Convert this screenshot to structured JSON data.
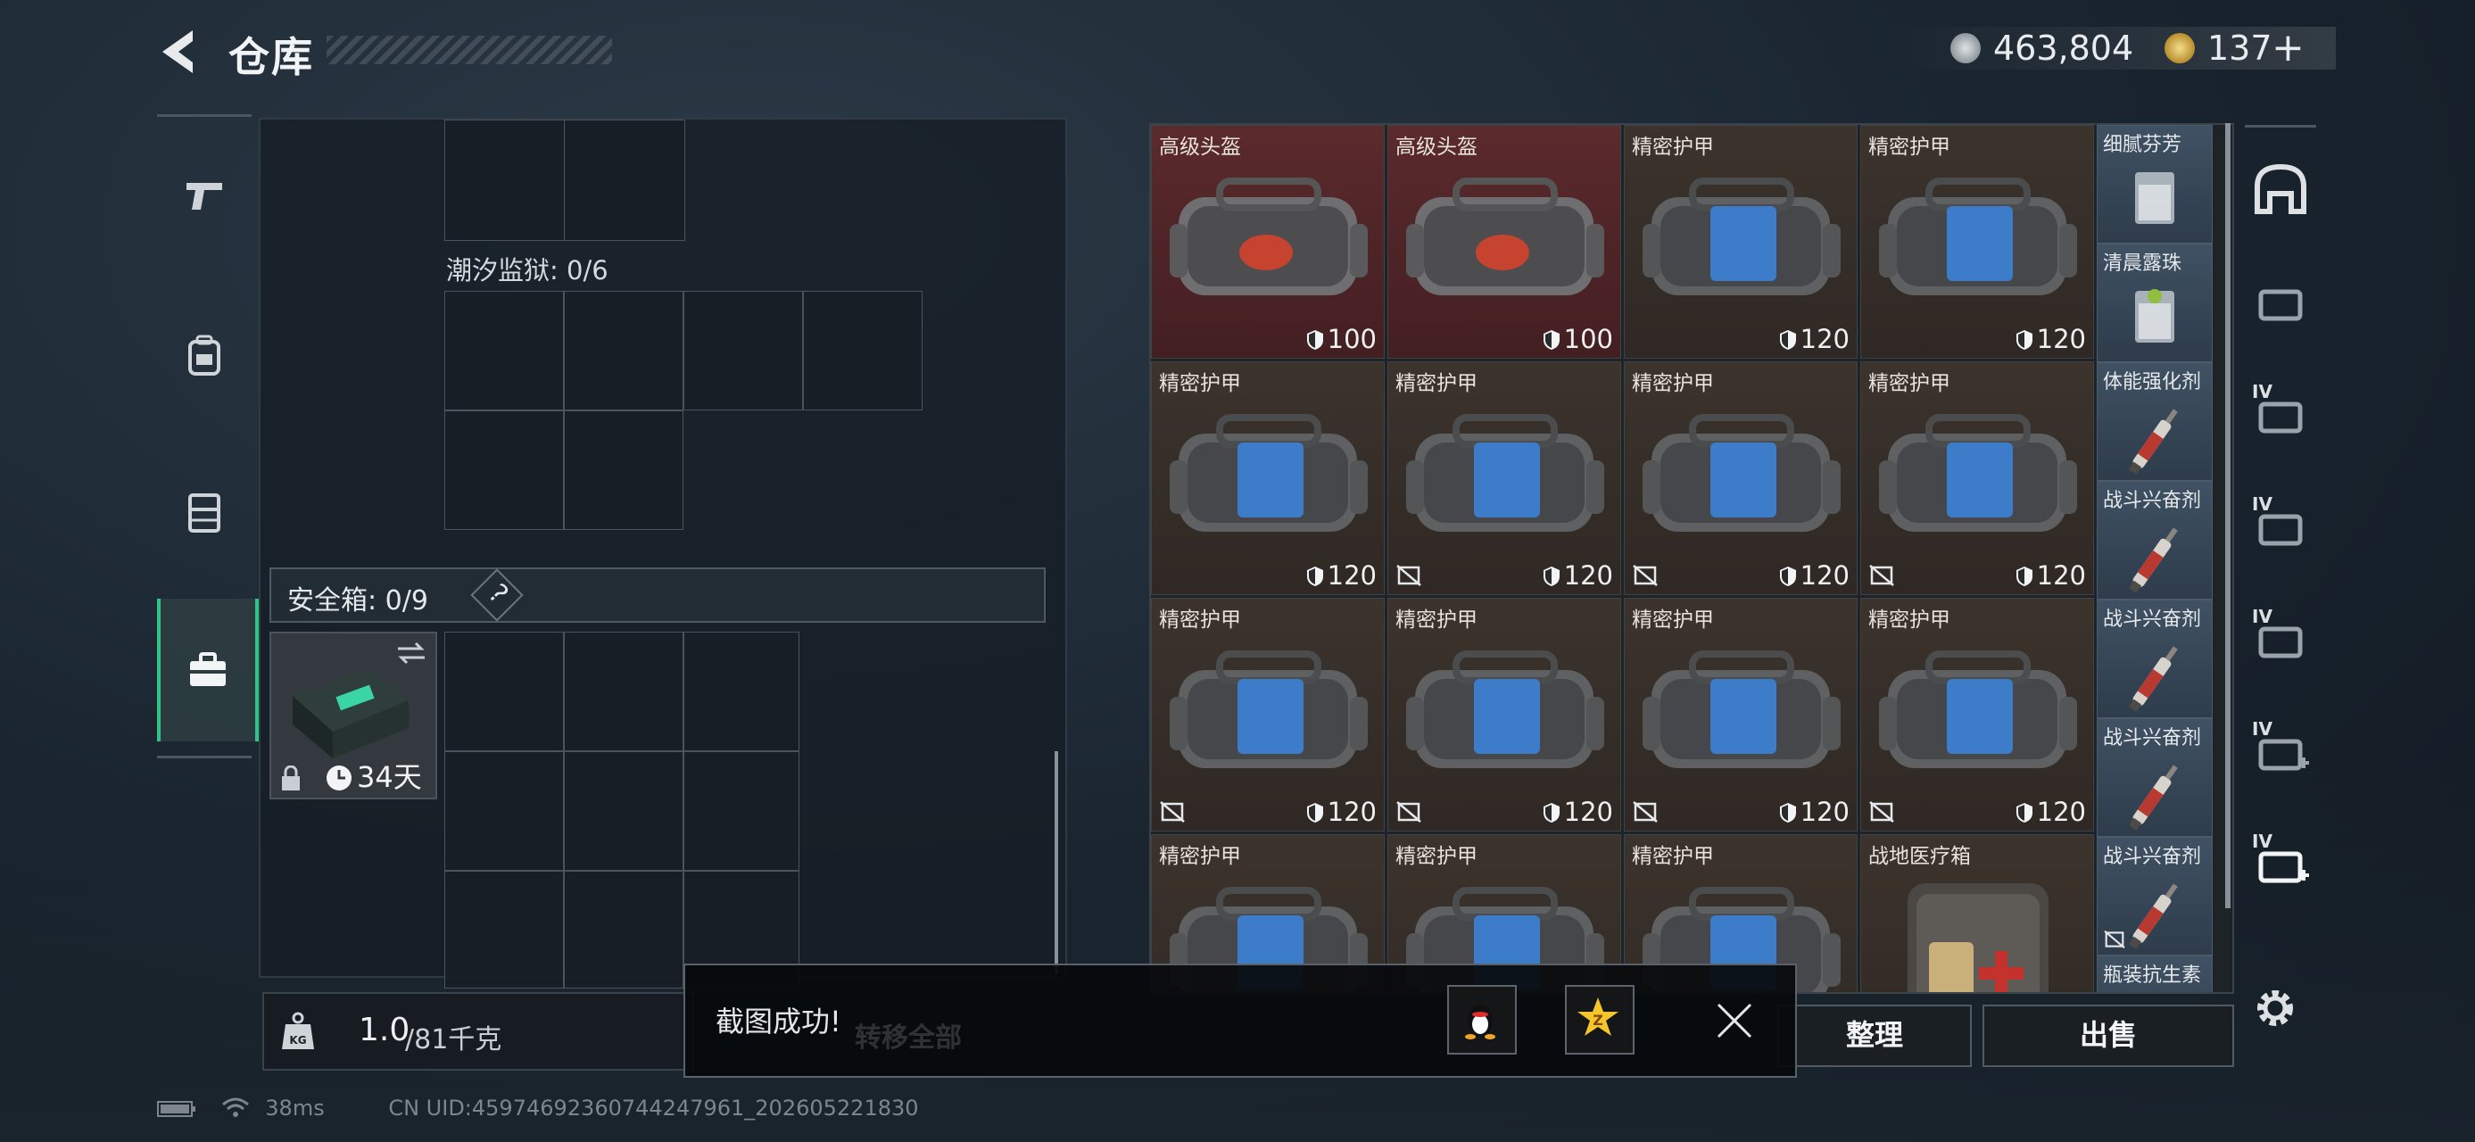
{
  "header": {
    "title": "仓库",
    "currency": [
      {
        "icon": "silver-coin-icon",
        "value": "463,804"
      },
      {
        "icon": "gold-coin-icon",
        "value": "137"
      }
    ],
    "currency_add": "+"
  },
  "left_nav": [
    {
      "icon": "pistol-icon"
    },
    {
      "icon": "backpack-icon"
    },
    {
      "icon": "vest-icon"
    },
    {
      "icon": "briefcase-icon",
      "active": true
    }
  ],
  "left_panel": {
    "prison_label": "潮汐监狱: 0/6",
    "safe_label": "安全箱: 0/9",
    "safe_help": "?",
    "safe_days": "34天"
  },
  "grid_cells": [
    {
      "name": "高级头盔",
      "durability": "100",
      "bg": "red",
      "item": "helmet",
      "nobind": false
    },
    {
      "name": "高级头盔",
      "durability": "100",
      "bg": "red",
      "item": "helmet",
      "nobind": false
    },
    {
      "name": "精密护甲",
      "durability": "120",
      "bg": "brown",
      "item": "armor",
      "nobind": false
    },
    {
      "name": "精密护甲",
      "durability": "120",
      "bg": "brown",
      "item": "armor",
      "nobind": false
    },
    {
      "name": "精密护甲",
      "durability": "120",
      "bg": "brown",
      "item": "armor",
      "nobind": false
    },
    {
      "name": "精密护甲",
      "durability": "120",
      "bg": "brown",
      "item": "armor",
      "nobind": true
    },
    {
      "name": "精密护甲",
      "durability": "120",
      "bg": "brown",
      "item": "armor",
      "nobind": true
    },
    {
      "name": "精密护甲",
      "durability": "120",
      "bg": "brown",
      "item": "armor",
      "nobind": true
    },
    {
      "name": "精密护甲",
      "durability": "120",
      "bg": "brown",
      "item": "armor",
      "nobind": true
    },
    {
      "name": "精密护甲",
      "durability": "120",
      "bg": "brown",
      "item": "armor",
      "nobind": true
    },
    {
      "name": "精密护甲",
      "durability": "120",
      "bg": "brown",
      "item": "armor",
      "nobind": true
    },
    {
      "name": "精密护甲",
      "durability": "120",
      "bg": "brown",
      "item": "armor",
      "nobind": true
    },
    {
      "name": "精密护甲",
      "durability": "",
      "bg": "brown",
      "item": "armor",
      "nobind": false
    },
    {
      "name": "精密护甲",
      "durability": "",
      "bg": "brown",
      "item": "armor",
      "nobind": false
    },
    {
      "name": "精密护甲",
      "durability": "",
      "bg": "brown",
      "item": "armor",
      "nobind": false
    },
    {
      "name": "战地医疗箱",
      "durability": "",
      "bg": "brown",
      "item": "medkit",
      "nobind": false
    }
  ],
  "small_cells": [
    {
      "name": "细腻芬芳",
      "item": "glass"
    },
    {
      "name": "清晨露珠",
      "item": "glass-mint"
    },
    {
      "name": "体能强化剂",
      "item": "syringe"
    },
    {
      "name": "战斗兴奋剂",
      "item": "syringe"
    },
    {
      "name": "战斗兴奋剂",
      "item": "syringe"
    },
    {
      "name": "战斗兴奋剂",
      "item": "syringe"
    },
    {
      "name": "战斗兴奋剂",
      "item": "syringe"
    },
    {
      "name": "瓶装抗生素",
      "item": "bottle"
    }
  ],
  "right_nav": [
    {
      "icon": "safe-helmet-icon",
      "label": ""
    },
    {
      "icon": "blueprint-icon",
      "label": ""
    },
    {
      "icon": "weapon-tier-icon",
      "label": "IV"
    },
    {
      "icon": "armor-tier-icon",
      "label": "IV"
    },
    {
      "icon": "bag-tier-icon",
      "label": "IV"
    },
    {
      "icon": "medkit-tier-icon",
      "label": "IV"
    },
    {
      "icon": "medkit-plus-tier-icon",
      "label": "IV"
    }
  ],
  "bottom": {
    "weight": "1.0",
    "weight_unit": "/81千克",
    "transfer_all": "转移全部",
    "organize": "整理",
    "sell": "出售"
  },
  "toast": {
    "text": "截图成功!"
  },
  "status_bar": {
    "ping": "38ms",
    "uid": "CN UID:4597469236074424796​1_202605221830"
  },
  "colors": {
    "accent_green": "#31c48a",
    "helmet_bg": "#5b2a2d",
    "armor_bg": "#3c332c",
    "consumable_bg": "#3f5163"
  }
}
